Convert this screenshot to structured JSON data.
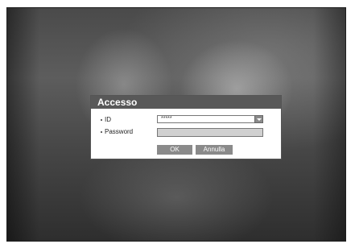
{
  "dialog": {
    "title": "Accesso",
    "id_label": "ID",
    "id_value": "*****",
    "password_label": "Password",
    "password_value": "",
    "ok_label": "OK",
    "cancel_label": "Annulla"
  },
  "colors": {
    "title_bar": "#585858",
    "button": "#8a8a8a",
    "password_field": "#d0d0d0"
  },
  "icons": {
    "dropdown": "chevron-down-icon",
    "bullet": "bullet-icon"
  }
}
